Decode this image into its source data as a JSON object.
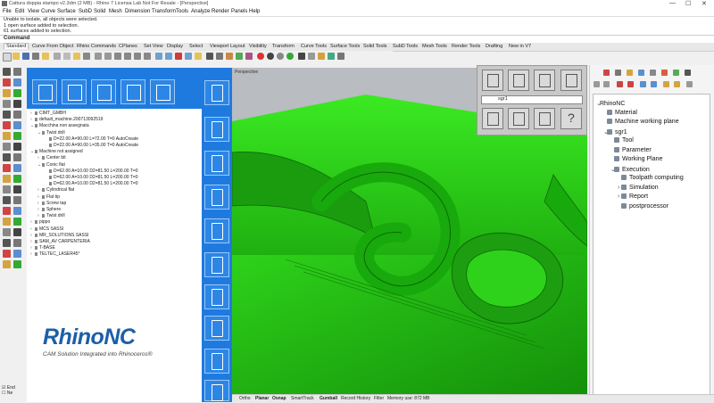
{
  "window": {
    "title": "Cattura doppia stampo v2.3dm (2 MB) - Rhino 7 Licensa Lab Not For Resale - [Perspective]",
    "controls": [
      "—",
      "☐",
      "✕"
    ]
  },
  "menu": [
    "File",
    "Edit",
    "View",
    "Curve",
    "Surface",
    "SubD",
    "Solid",
    "Mesh",
    "Dimension",
    "Transform",
    "Tools",
    "Analyze",
    "Render",
    "Panels",
    "Help"
  ],
  "command_history": [
    "Unable to isolate, all objects were selected.",
    "1 open surface added to selection.",
    "61 surfaces added to selection."
  ],
  "command_prompt": "Command",
  "tabs": [
    "Standard",
    "Curve From Object",
    "Rhino Commands",
    "CPlanes",
    "Set View",
    "Display",
    "Select",
    "Viewport Layout",
    "Visibility",
    "Transform",
    "Curve Tools",
    "Surface Tools",
    "Solid Tools",
    "SubD Tools",
    "Mesh Tools",
    "Render Tools",
    "Drafting",
    "New in V7"
  ],
  "cam_tree": [
    {
      "label": "CIMT_GMBH",
      "level": 0,
      "toggle": "+"
    },
    {
      "label": "default_machine.200713092519",
      "level": 0,
      "toggle": "+"
    },
    {
      "label": "Macchina non assegnata",
      "level": 0,
      "toggle": "−"
    },
    {
      "label": "Twist drill",
      "level": 1,
      "toggle": "−"
    },
    {
      "label": "D=22.00  A=90.00  L=72.00  T=0   AutoCreate",
      "level": 2,
      "toggle": ""
    },
    {
      "label": "D=22.00  A=90.00  L=35.00  T=0   AutoCreate",
      "level": 2,
      "toggle": ""
    },
    {
      "label": "Machine not assigned",
      "level": 0,
      "toggle": "−"
    },
    {
      "label": "Center bit",
      "level": 1,
      "toggle": "+"
    },
    {
      "label": "Conic flat",
      "level": 1,
      "toggle": "−"
    },
    {
      "label": "D=62.00  A=10.00  D2=81.50  L=200.00  T=0",
      "level": 2,
      "toggle": ""
    },
    {
      "label": "D=62.00  A=10.00  D2=81.50  L=200.00  T=0",
      "level": 2,
      "toggle": ""
    },
    {
      "label": "D=62.00  A=10.00  D2=81.50  L=200.00  T=0",
      "level": 2,
      "toggle": ""
    },
    {
      "label": "Cylindrical flat",
      "level": 1,
      "toggle": "+"
    },
    {
      "label": "Flat tip",
      "level": 1,
      "toggle": "+"
    },
    {
      "label": "Screw tap",
      "level": 1,
      "toggle": "+"
    },
    {
      "label": "Sphere",
      "level": 1,
      "toggle": "+"
    },
    {
      "label": "Twist drill",
      "level": 1,
      "toggle": "+"
    },
    {
      "label": "pippo",
      "level": 0,
      "toggle": "+"
    },
    {
      "label": "MCS SASSI",
      "level": 0,
      "toggle": "+"
    },
    {
      "label": "MR_SOLUTIONS SASSI",
      "level": 0,
      "toggle": "+"
    },
    {
      "label": "SAM_AV CARPENTERIA",
      "level": 0,
      "toggle": "+"
    },
    {
      "label": "T-BASE",
      "level": 0,
      "toggle": "+"
    },
    {
      "label": "TELTEC_LASER45°",
      "level": 0,
      "toggle": "+"
    }
  ],
  "logo": {
    "text": "RhinoNC",
    "tagline": "CAM Solution Integrated into Rhinoceros®"
  },
  "viewport_label": "Perspective",
  "float_panel": {
    "selector": "sgr1"
  },
  "rhinonc_tree": [
    {
      "label": "RhinoNC",
      "level": 0,
      "toggle": "−"
    },
    {
      "label": "Material",
      "level": 1,
      "toggle": ""
    },
    {
      "label": "Machine working plane",
      "level": 1,
      "toggle": ""
    },
    {
      "label": "sgr1",
      "level": 1,
      "toggle": "−"
    },
    {
      "label": "Tool",
      "level": 2,
      "toggle": ""
    },
    {
      "label": "Parameter",
      "level": 2,
      "toggle": ""
    },
    {
      "label": "Working Plane",
      "level": 2,
      "toggle": ""
    },
    {
      "label": "Execution",
      "level": 2,
      "toggle": "−"
    },
    {
      "label": "Toolpath computing",
      "level": 3,
      "toggle": ""
    },
    {
      "label": "Simulation",
      "level": 3,
      "toggle": "+"
    },
    {
      "label": "Report",
      "level": 3,
      "toggle": "+"
    },
    {
      "label": "postprocessor",
      "level": 3,
      "toggle": ""
    }
  ],
  "status": [
    "Ortho",
    "Planar",
    "Osnap",
    "SmartTrack",
    "Gumball",
    "Record History",
    "Filter",
    "Memory use: 872 MB"
  ],
  "status_active": [
    "Planar",
    "Osnap",
    "Gumball"
  ],
  "osnap": [
    "End",
    "Ne"
  ],
  "colors": {
    "cam_blue": "#1f7ae0",
    "model_green": "#2fe01a",
    "viewport_bg": "#b9bcc0"
  }
}
